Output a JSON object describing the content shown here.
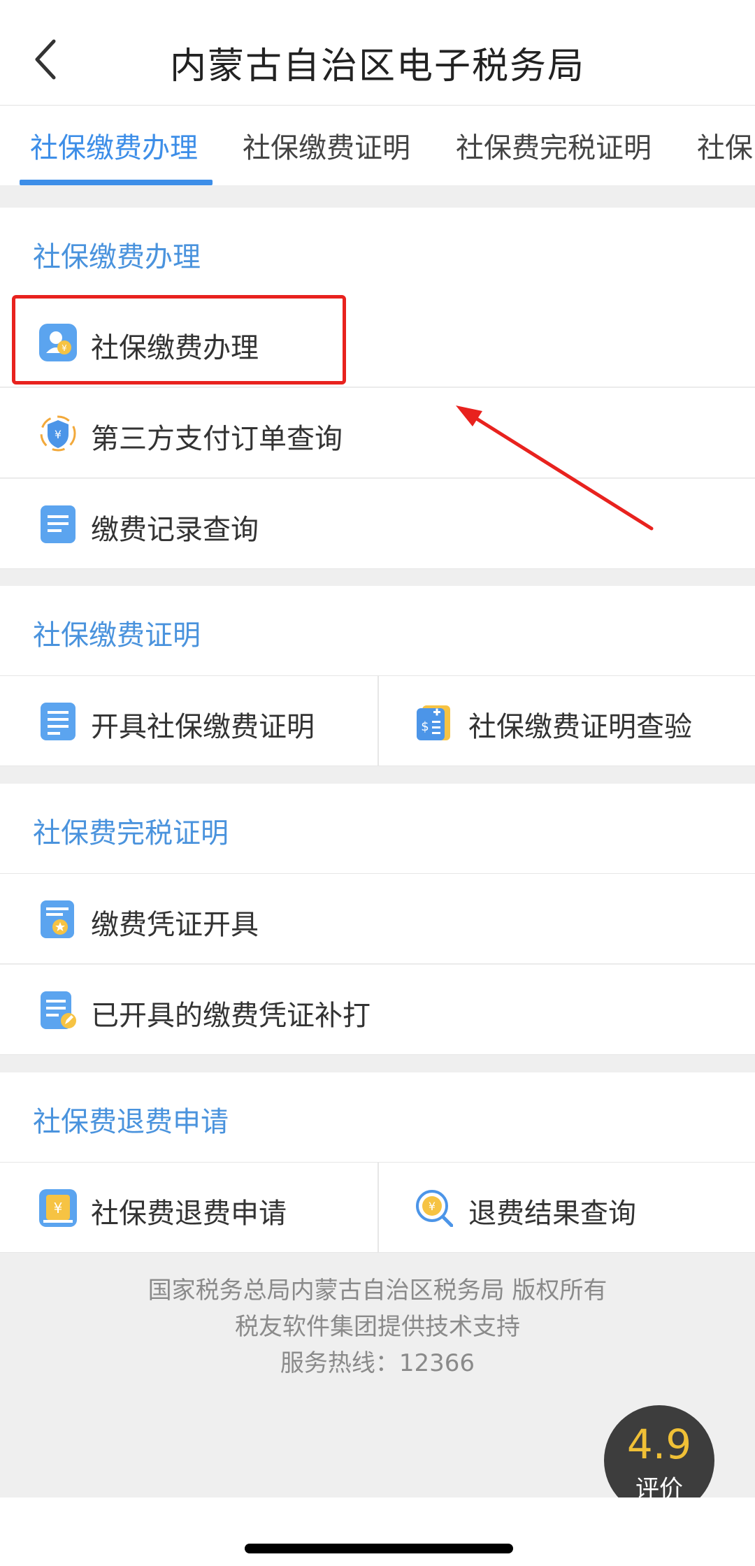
{
  "header": {
    "title": "内蒙古自治区电子税务局"
  },
  "tabs": [
    "社保缴费办理",
    "社保缴费证明",
    "社保费完税证明",
    "社保"
  ],
  "sections": {
    "s1": {
      "title": "社保缴费办理",
      "items": [
        "社保缴费办理",
        "第三方支付订单查询",
        "缴费记录查询"
      ]
    },
    "s2": {
      "title": "社保缴费证明",
      "items": [
        "开具社保缴费证明",
        "社保缴费证明查验"
      ]
    },
    "s3": {
      "title": "社保费完税证明",
      "items": [
        "缴费凭证开具",
        "已开具的缴费凭证补打"
      ]
    },
    "s4": {
      "title": "社保费退费申请",
      "items": [
        "社保费退费申请",
        "退费结果查询"
      ]
    }
  },
  "footer": {
    "line1": "国家税务总局内蒙古自治区税务局 版权所有",
    "line2": "税友软件集团提供技术支持",
    "line3": "服务热线：12366"
  },
  "rating": {
    "score": "4.9",
    "label": "评价"
  },
  "colors": {
    "accent": "#3d8ee8",
    "highlight": "#e8221e",
    "rating_score": "#f0c036"
  },
  "icons": {
    "back": "chevron-left-icon",
    "s1_items": [
      "user-payment-icon",
      "shield-yuan-icon",
      "document-list-icon"
    ],
    "s2_items": [
      "document-list-icon",
      "receipt-plus-icon"
    ],
    "s3_items": [
      "certificate-star-icon",
      "document-edit-icon"
    ],
    "s4_items": [
      "yuan-box-icon",
      "search-yuan-icon"
    ]
  }
}
